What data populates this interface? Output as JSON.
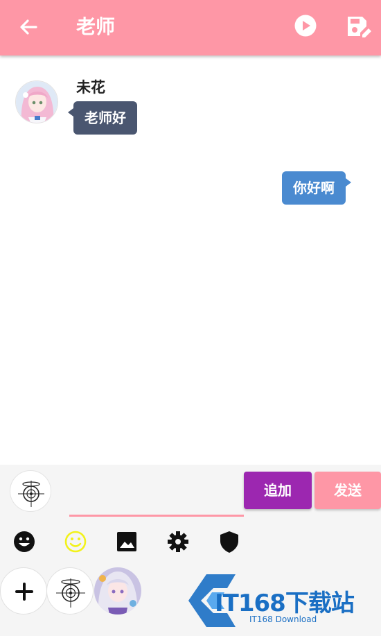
{
  "header": {
    "title": "老师",
    "background": "#fe97a6",
    "back_icon": "arrow-left-icon",
    "play_icon": "play-circle-icon",
    "save_icon": "save-edit-icon"
  },
  "chat": {
    "messages": [
      {
        "side": "left",
        "sender": "未花",
        "text": "老师好",
        "bubble_color": "#4a5670"
      },
      {
        "side": "right",
        "text": "你好啊",
        "bubble_color": "#4a8ad0"
      }
    ]
  },
  "composer": {
    "input_value": "",
    "add_label": "追加",
    "send_label": "发送",
    "add_color": "#9c27b0",
    "send_color": "#fe97a6"
  },
  "toolbar": {
    "icons": [
      "emoji-black-icon",
      "emoji-yellow-icon",
      "image-icon",
      "gear-icon",
      "shield-icon"
    ]
  },
  "characters": {
    "items": [
      "add-character-icon",
      "sensei-halo-avatar",
      "character-avatar"
    ]
  },
  "watermark": {
    "text": "IT168下载站",
    "subtext": "IT168 Download"
  }
}
